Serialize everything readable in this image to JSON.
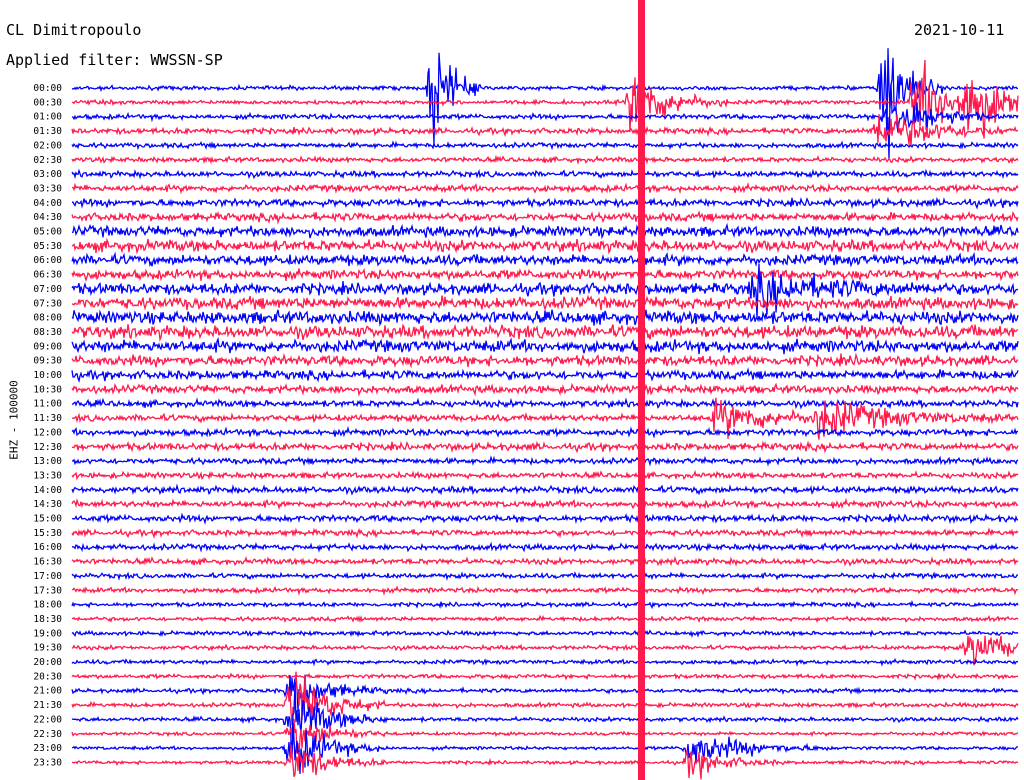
{
  "header": {
    "station": "CL Dimitropoulo",
    "filter": "Applied filter: WWSSN-SP",
    "date": "2021-10-11"
  },
  "chart_data": {
    "type": "line",
    "title": "CL Dimitropoulo",
    "subtitle": "Applied filter: WWSSN-SP",
    "date": "2021-10-11",
    "ylabel": "EHZ - 100000",
    "row_times": [
      "00:00",
      "00:30",
      "01:00",
      "01:30",
      "02:00",
      "02:30",
      "03:00",
      "03:30",
      "04:00",
      "04:30",
      "05:00",
      "05:30",
      "06:00",
      "06:30",
      "07:00",
      "07:30",
      "08:00",
      "08:30",
      "09:00",
      "09:30",
      "10:00",
      "10:30",
      "11:00",
      "11:30",
      "12:00",
      "12:30",
      "13:00",
      "13:30",
      "14:00",
      "14:30",
      "15:00",
      "15:30",
      "16:00",
      "16:30",
      "17:00",
      "17:30",
      "18:00",
      "18:30",
      "19:00",
      "19:30",
      "20:00",
      "20:30",
      "21:00",
      "21:30",
      "22:00",
      "22:30",
      "23:00",
      "23:30"
    ],
    "series_colors": [
      "#0000ff",
      "#ff1a4d"
    ],
    "grid": false,
    "row_noise_level": [
      0.5,
      0.5,
      0.6,
      0.7,
      0.6,
      0.6,
      0.7,
      0.8,
      0.9,
      1.0,
      1.3,
      1.4,
      1.3,
      1.2,
      1.4,
      1.5,
      1.6,
      1.6,
      1.5,
      1.3,
      1.1,
      1.0,
      0.8,
      0.8,
      0.8,
      0.9,
      0.7,
      0.7,
      0.8,
      0.8,
      0.8,
      0.7,
      0.7,
      0.7,
      0.6,
      0.6,
      0.5,
      0.5,
      0.5,
      0.5,
      0.5,
      0.5,
      0.5,
      0.5,
      0.5,
      0.4,
      0.4,
      0.4
    ],
    "events": [
      {
        "row": 0,
        "minute": 11.5,
        "amplitude": 8,
        "duration_min": 0.5
      },
      {
        "row": 1,
        "minute": 17.8,
        "amplitude": 5,
        "duration_min": 1.0
      },
      {
        "row": 0,
        "minute": 25.8,
        "amplitude": 9,
        "duration_min": 0.6
      },
      {
        "row": 1,
        "minute": 28.4,
        "amplitude": 5,
        "duration_min": 1.2
      },
      {
        "row": 1,
        "minute": 26.8,
        "amplitude": 6,
        "duration_min": 1.0
      },
      {
        "row": 2,
        "minute": 25.9,
        "amplitude": 5,
        "duration_min": 1.0
      },
      {
        "row": 3,
        "minute": 25.6,
        "amplitude": 3,
        "duration_min": 1.5
      },
      {
        "row": 14,
        "minute": 21.7,
        "amplitude": 2.5,
        "duration_min": 2.0
      },
      {
        "row": 23,
        "minute": 20.5,
        "amplitude": 2.5,
        "duration_min": 1.5
      },
      {
        "row": 23,
        "minute": 23.7,
        "amplitude": 2.5,
        "duration_min": 2.0
      },
      {
        "row": 39,
        "minute": 28.5,
        "amplitude": 2.5,
        "duration_min": 1.5
      },
      {
        "row": 42,
        "minute": 7.0,
        "amplitude": 3,
        "duration_min": 1.0
      },
      {
        "row": 43,
        "minute": 7.0,
        "amplitude": 5,
        "duration_min": 1.0
      },
      {
        "row": 44,
        "minute": 7.0,
        "amplitude": 4,
        "duration_min": 1.0
      },
      {
        "row": 45,
        "minute": 7.0,
        "amplitude": 3,
        "duration_min": 1.0
      },
      {
        "row": 46,
        "minute": 7.0,
        "amplitude": 4,
        "duration_min": 1.0
      },
      {
        "row": 47,
        "minute": 7.0,
        "amplitude": 3,
        "duration_min": 1.0
      },
      {
        "row": 46,
        "minute": 19.6,
        "amplitude": 2.5,
        "duration_min": 1.5
      },
      {
        "row": 47,
        "minute": 19.6,
        "amplitude": 2,
        "duration_min": 1.0
      }
    ],
    "vertical_spike_minute": 16.0
  }
}
